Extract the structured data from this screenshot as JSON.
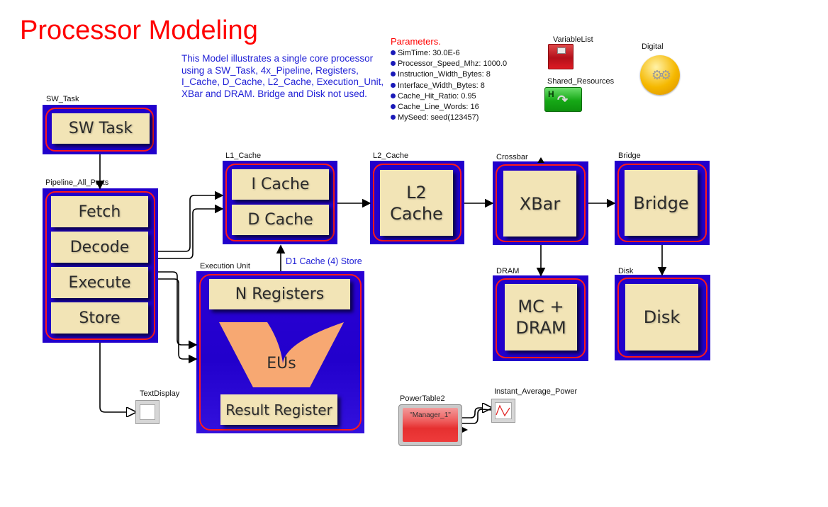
{
  "title": "Processor Modeling",
  "description": "This Model illustrates a single core processor using a SW_Task, 4x_Pipeline, Registers, I_Cache, D_Cache, L2_Cache, Execution_Unit, XBar and DRAM.  Bridge and Disk not used.",
  "parameters": {
    "title": "Parameters.",
    "items": [
      "SimTime: 30.0E-6",
      "Processor_Speed_Mhz: 1000.0",
      "Instruction_Width_Bytes: 8",
      "Interface_Width_Bytes: 8",
      "Cache_Hit_Ratio: 0.95",
      "Cache_Line_Words: 16",
      "MySeed: seed(123457)"
    ]
  },
  "tools": {
    "variable_list": "VariableList",
    "shared_resources": "Shared_Resources",
    "shared_resources_glyph": "H",
    "digital": "Digital",
    "digital_glyph": "⚙⚙"
  },
  "blocks": {
    "sw_task": {
      "label": "SW_Task",
      "tile": "SW Task"
    },
    "pipeline": {
      "label": "Pipeline_All_Ports",
      "stages": [
        "Fetch",
        "Decode",
        "Execute",
        "Store"
      ]
    },
    "l1_cache": {
      "label": "L1_Cache",
      "tiles": [
        "I Cache",
        "D Cache"
      ]
    },
    "l2_cache": {
      "label": "L2_Cache",
      "tile_line1": "L2",
      "tile_line2": "Cache"
    },
    "crossbar": {
      "label": "Crossbar",
      "tile": "XBar"
    },
    "bridge": {
      "label": "Bridge",
      "tile": "Bridge"
    },
    "dram": {
      "label": "DRAM",
      "tile_line1": "MC +",
      "tile_line2": "DRAM"
    },
    "disk": {
      "label": "Disk",
      "tile": "Disk"
    },
    "execution_unit": {
      "label": "Execution Unit",
      "registers": "N Registers",
      "eus": "EUs",
      "result": "Result Register"
    }
  },
  "annotations": {
    "d1_cache_store": "D1 Cache (4) Store"
  },
  "outputs": {
    "text_display": "TextDisplay",
    "power_table": "PowerTable2",
    "power_table_value": "\"Manager_1\"",
    "instant_average_power": "Instant_Average_Power"
  },
  "colors": {
    "title": "#ff0000",
    "description": "#1f1fd6",
    "block_fill": "#2200cc",
    "block_ring": "#ff1a1a",
    "tile": "#f2e4b6",
    "eu_shape": "#f7a872"
  }
}
